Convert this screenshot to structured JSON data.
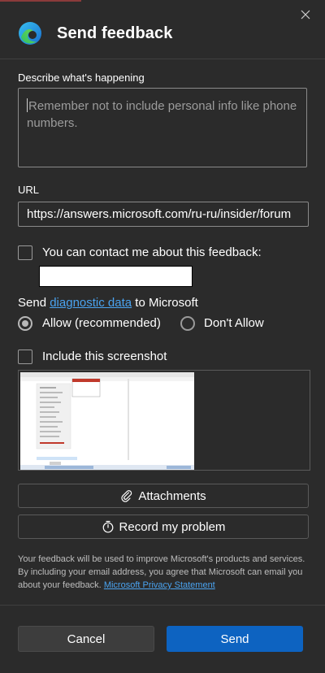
{
  "header": {
    "title": "Send feedback"
  },
  "describe": {
    "label": "Describe what's happening",
    "placeholder": "Remember not to include personal info like phone numbers."
  },
  "url": {
    "label": "URL",
    "value": "https://answers.microsoft.com/ru-ru/insider/forum"
  },
  "contact": {
    "label": "You can contact me about this feedback:",
    "checked": false
  },
  "diagnostic": {
    "prefix": "Send ",
    "link": "diagnostic data",
    "suffix": " to Microsoft",
    "allow": "Allow (recommended)",
    "dont_allow": "Don't Allow",
    "selected": "allow"
  },
  "screenshot": {
    "label": "Include this screenshot",
    "checked": false
  },
  "buttons": {
    "attachments": "Attachments",
    "record": "Record my problem",
    "cancel": "Cancel",
    "send": "Send"
  },
  "disclaimer": {
    "text": "Your feedback will be used to improve Microsoft's products and services. By including your email address, you agree that Microsoft can email you about your feedback.",
    "link": "Microsoft Privacy Statement"
  },
  "icons": [
    "close-icon",
    "edge-logo-icon",
    "paperclip-icon",
    "stopwatch-icon"
  ],
  "colors": {
    "background": "#2b2b2b",
    "accent": "#0d63c1",
    "link": "#4aa3f0"
  }
}
